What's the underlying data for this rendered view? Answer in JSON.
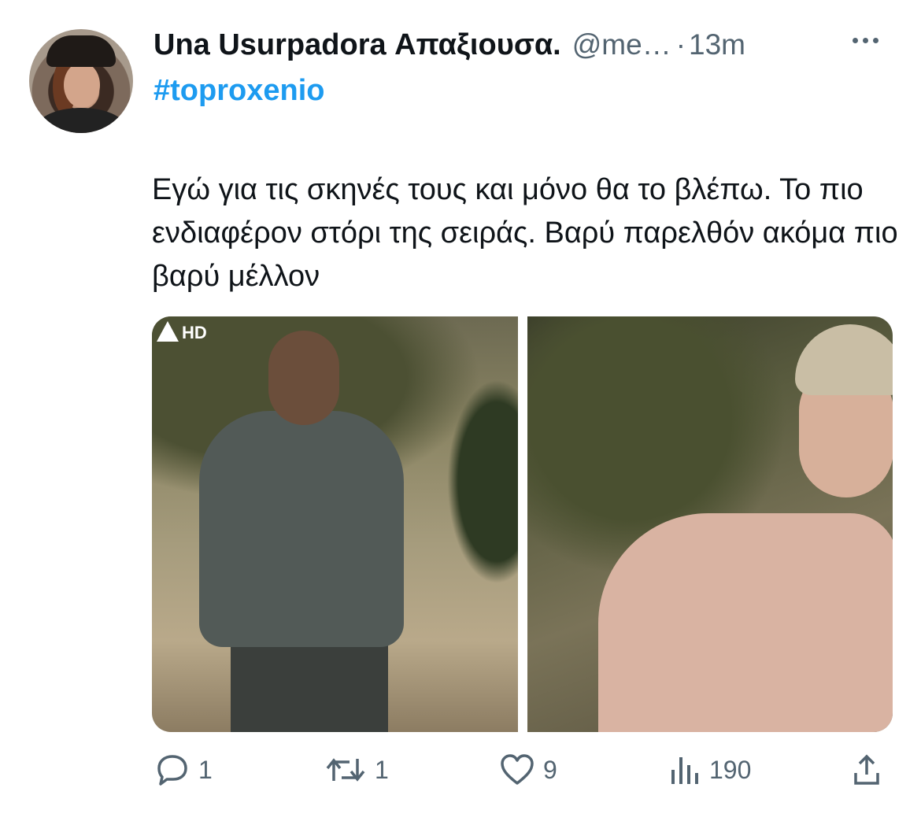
{
  "tweet": {
    "author_name": "Una Usurpadora Απαξιουσα.",
    "handle": "@me…",
    "separator": "·",
    "time": "13m",
    "hashtag": "#toproxenio",
    "text": "Εγώ για τις σκηνές τους και μόνο θα το βλέπω. Το πιο ενδιαφέρον στόρι της σειράς. Βαρύ παρελθόν ακόμα πιο βαρύ μέλλον",
    "media": {
      "left_badge": "HD"
    },
    "actions": {
      "replies": "1",
      "retweets": "1",
      "likes": "9",
      "views": "190"
    }
  },
  "colors": {
    "accent": "#1d9bf0",
    "text_primary": "#0f1419",
    "text_secondary": "#536471"
  }
}
